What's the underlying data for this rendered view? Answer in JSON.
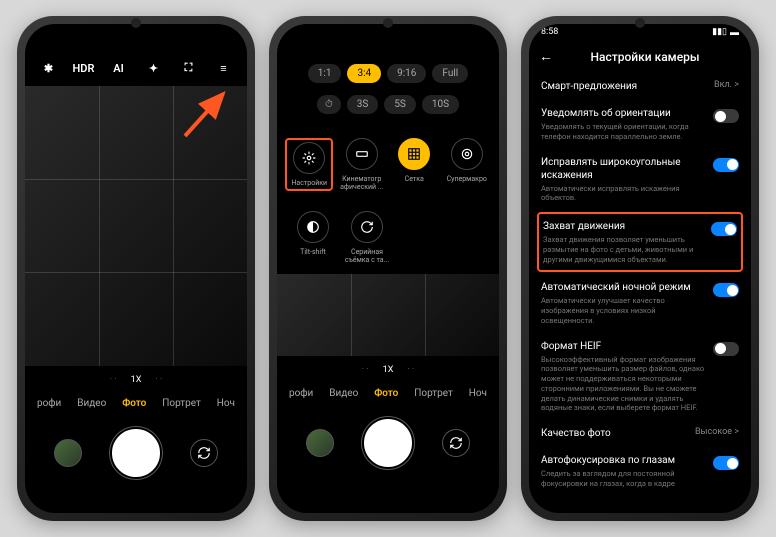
{
  "phone1": {
    "top_icons": {
      "flash": "✱",
      "hdr": "HDR",
      "ai": "AI",
      "filter": "✦",
      "scan": "⛶",
      "menu": "≡"
    },
    "zoom": {
      "dots_left": "· ·",
      "current": "1X",
      "dots_right": "· ·"
    },
    "modes": [
      "рофи",
      "Видео",
      "Фото",
      "Портрет",
      "Ноч"
    ],
    "active_mode_index": 2
  },
  "phone2": {
    "ratios": [
      "1:1",
      "3:4",
      "9:16",
      "Full"
    ],
    "active_ratio_index": 1,
    "timers": [
      "⏱",
      "3S",
      "5S",
      "10S"
    ],
    "options_row1": [
      {
        "label": "Настройки",
        "symbol": "⚙"
      },
      {
        "label": "Кинематогр афический ...",
        "symbol": "▭"
      },
      {
        "label": "Сетка",
        "symbol": "⊞"
      },
      {
        "label": "Супермакро",
        "symbol": "◎"
      }
    ],
    "options_row2": [
      {
        "label": "Tilt-shift",
        "symbol": "◐"
      },
      {
        "label": "Серийная съёмка с та...",
        "symbol": "↻"
      }
    ],
    "highlighted_option": 0,
    "active_option": 2,
    "zoom": {
      "dots_left": "· ·",
      "current": "1X",
      "dots_right": "· ·"
    },
    "modes": [
      "рофи",
      "Видео",
      "Фото",
      "Портрет",
      "Ноч"
    ],
    "active_mode_index": 2
  },
  "phone3": {
    "status_time": "8:58",
    "title": "Настройки камеры",
    "items": [
      {
        "label": "Смарт-предложения",
        "value": "Вкл. >",
        "type": "link"
      },
      {
        "label": "Уведомлять об ориентации",
        "desc": "Уведомлять о текущей ориентации, когда телефон находится параллельно земле.",
        "toggle": false
      },
      {
        "label": "Исправлять широкоугольные искажения",
        "desc": "Автоматически исправлять искажения объектов.",
        "toggle": true
      },
      {
        "label": "Захват движения",
        "desc": "Захват движения позволяет уменьшить размытие на фото с детьми, животными и другими движущимися объектами.",
        "toggle": true,
        "highlight": true
      },
      {
        "label": "Автоматический ночной режим",
        "desc": "Автоматически улучшает качество изображения в условиях низкой освещенности.",
        "toggle": true
      },
      {
        "label": "Формат HEIF",
        "desc": "Высокоэффективный формат изображения позволяет уменьшить размер файлов, однако может не поддерживаться некоторыми сторонними приложениями. Вы не сможете делать динамические снимки и удалять водяные знаки, если выберете формат HEIF.",
        "toggle": false
      },
      {
        "label": "Качество фото",
        "value": "Высокое >",
        "type": "link"
      },
      {
        "label": "Автофокусировка по глазам",
        "desc": "Следить за взглядом для постоянной фокусировки на глазах, когда в кадре",
        "toggle": true
      }
    ]
  }
}
